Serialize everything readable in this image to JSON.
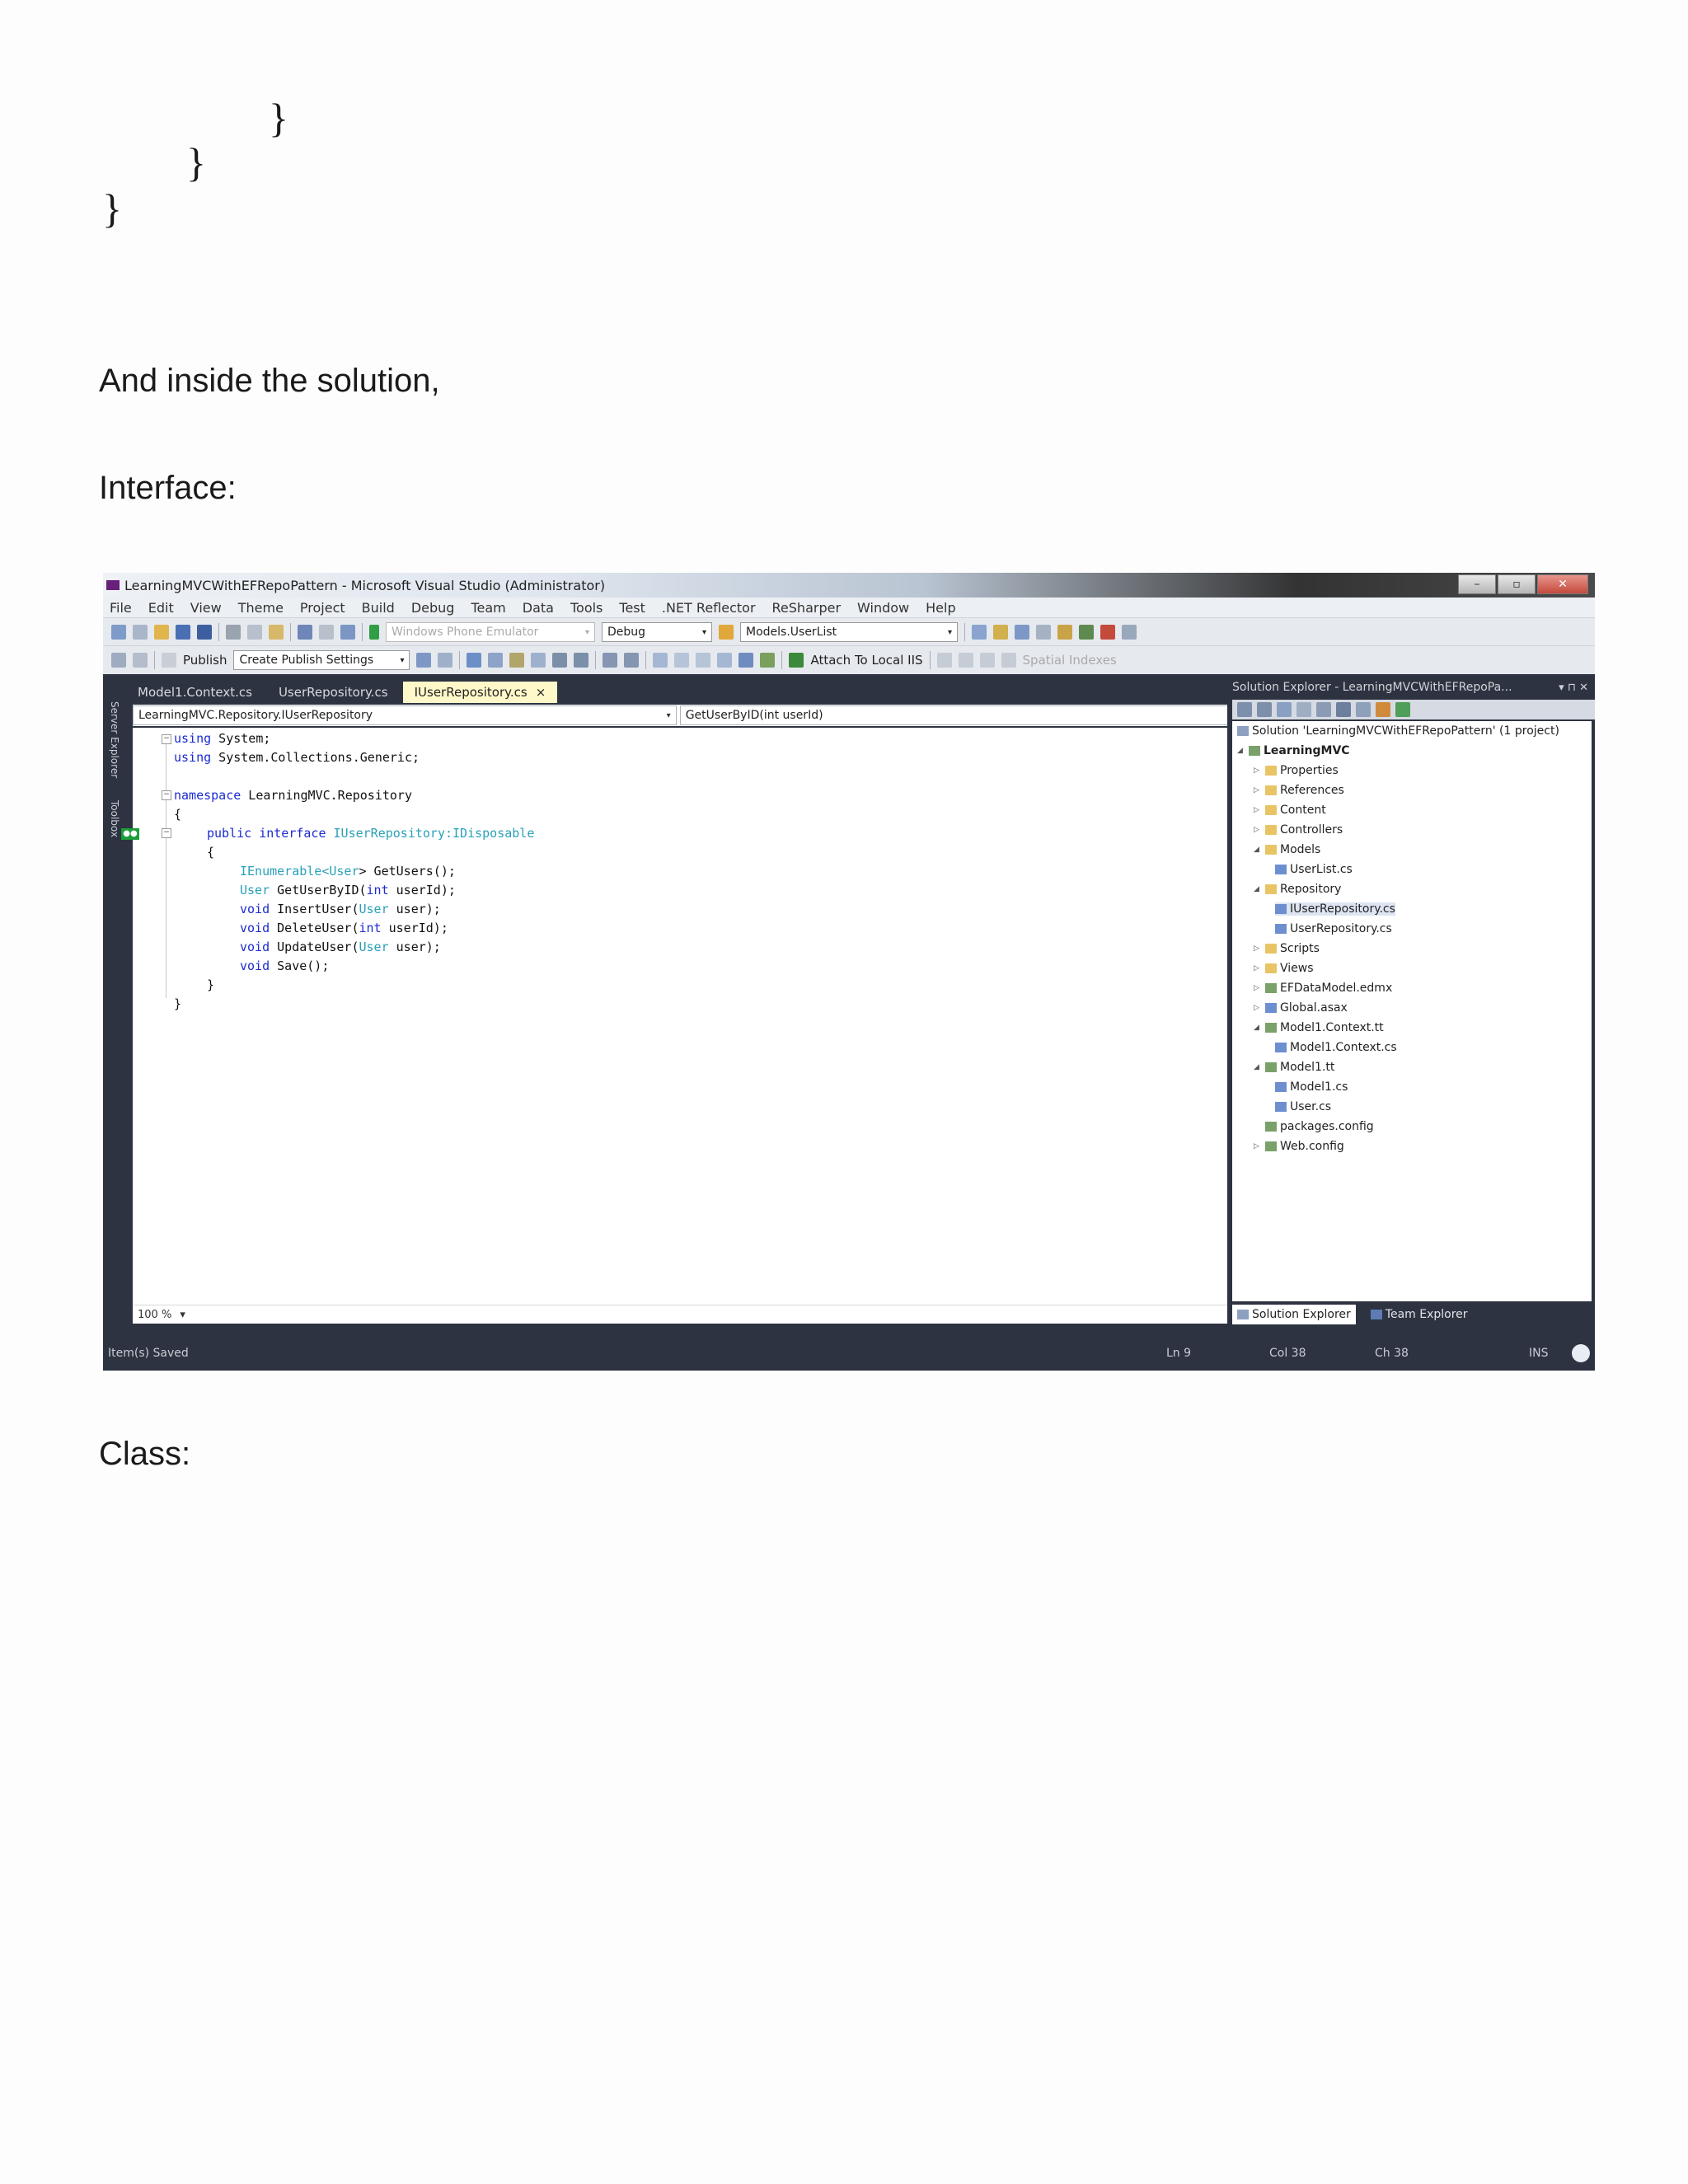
{
  "doc": {
    "brace1": "}",
    "brace2": "}",
    "brace3": "}",
    "para1": "And inside the solution,",
    "para2": "Interface:",
    "para3": "Class:"
  },
  "vs": {
    "title": "LearningMVCWithEFRepoPattern - Microsoft Visual Studio (Administrator)",
    "window_buttons": [
      "–",
      "▫",
      "✕"
    ],
    "menu": [
      "File",
      "Edit",
      "View",
      "Theme",
      "Project",
      "Build",
      "Debug",
      "Team",
      "Data",
      "Tools",
      "Test",
      ".NET Reflector",
      "ReSharper",
      "Window",
      "Help"
    ],
    "toolbar1": {
      "emulator": "Windows Phone Emulator",
      "config": "Debug",
      "startup": "Models.UserList"
    },
    "toolbar2": {
      "publish": "Publish",
      "publish_settings": "Create Publish Settings",
      "attach": "Attach To Local IIS",
      "spatial": "Spatial Indexes"
    },
    "side_tabs": [
      "Server Explorer",
      "Toolbox"
    ],
    "doc_tabs": [
      "Model1.Context.cs",
      "UserRepository.cs",
      "IUserRepository.cs"
    ],
    "active_tab_close": "×",
    "nav_left": "LearningMVC.Repository.IUserRepository",
    "nav_right": "GetUserByID(int userId)",
    "code": {
      "l1a": "using",
      "l1b": " System;",
      "l2a": "using",
      "l2b": " System.Collections.Generic;",
      "l4a": "namespace",
      "l4b": " LearningMVC.Repository",
      "l5": "{",
      "l6a": "public",
      "l6b": " ",
      "l6c": "interface",
      "l6d": " ",
      "l6e": "IUserRepository",
      "l6f": ":",
      "l6g": "IDisposable",
      "l7": "{",
      "l8a": "IEnumerable",
      "l8b": "<",
      "l8c": "User",
      "l8d": "> GetUsers();",
      "l9a": "User",
      "l9b": " GetUserByID(",
      "l9c": "int",
      "l9d": " userId);",
      "l10a": "void",
      "l10b": " InsertUser(",
      "l10c": "User",
      "l10d": " user);",
      "l11a": "void",
      "l11b": " DeleteUser(",
      "l11c": "int",
      "l11d": " userId);",
      "l12a": "void",
      "l12b": " UpdateUser(",
      "l12c": "User",
      "l12d": " user);",
      "l13a": "void",
      "l13b": " Save();",
      "l14": "}",
      "l15": "}"
    },
    "zoom": "100 %",
    "solution": {
      "title": "Solution Explorer - LearningMVCWithEFRepoPa...",
      "root": "Solution 'LearningMVCWithEFRepoPattern' (1 project)",
      "project": "LearningMVC",
      "items": [
        "Properties",
        "References",
        "Content",
        "Controllers",
        "Models",
        "UserList.cs",
        "Repository",
        "IUserRepository.cs",
        "UserRepository.cs",
        "Scripts",
        "Views",
        "EFDataModel.edmx",
        "Global.asax",
        "Model1.Context.tt",
        "Model1.Context.cs",
        "Model1.tt",
        "Model1.cs",
        "User.cs",
        "packages.config",
        "Web.config"
      ],
      "tabs": [
        "Solution Explorer",
        "Team Explorer"
      ]
    },
    "status": {
      "message": "Item(s) Saved",
      "ln": "Ln 9",
      "col": "Col 38",
      "ch": "Ch 38",
      "ins": "INS"
    }
  }
}
